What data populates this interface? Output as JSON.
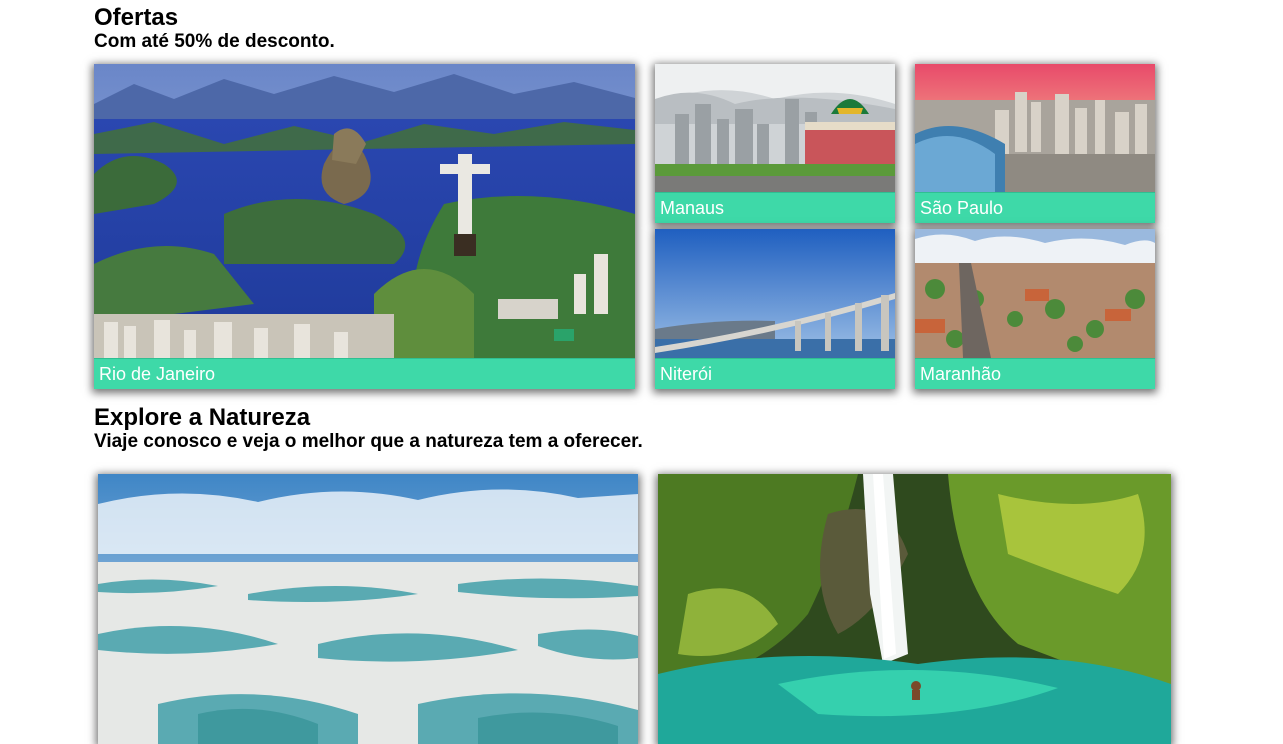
{
  "offers": {
    "title": "Ofertas",
    "subtitle": "Com até 50% de desconto.",
    "cards": [
      {
        "label": "Rio de Janeiro"
      },
      {
        "label": "Manaus"
      },
      {
        "label": "São Paulo"
      },
      {
        "label": "Niterói"
      },
      {
        "label": "Maranhão"
      }
    ]
  },
  "nature": {
    "title": "Explore a Natureza",
    "subtitle": "Viaje conosco e veja o melhor que a natureza tem a oferecer."
  },
  "colors": {
    "caption_bg": "#3ed9a8",
    "caption_text": "#ffffff"
  }
}
